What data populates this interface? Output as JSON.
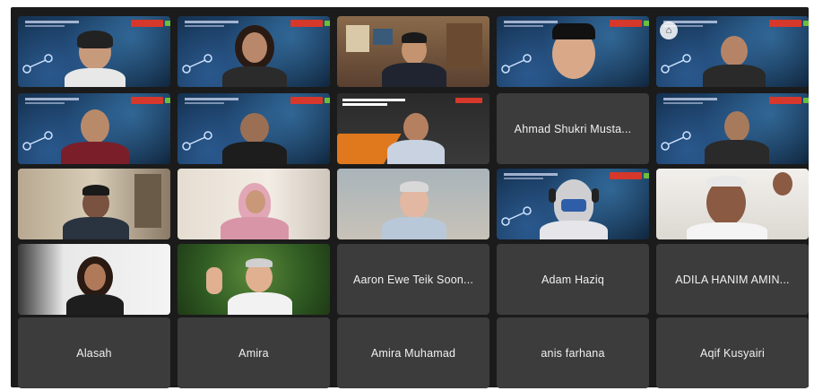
{
  "meeting": {
    "participants": [
      {
        "name": "",
        "video": true
      },
      {
        "name": "",
        "video": true
      },
      {
        "name": "",
        "video": true
      },
      {
        "name": "",
        "video": true
      },
      {
        "name": "",
        "video": true
      },
      {
        "name": "",
        "video": true
      },
      {
        "name": "",
        "video": true
      },
      {
        "name": "",
        "video": true
      },
      {
        "name": "Ahmad Shukri Musta...",
        "video": false
      },
      {
        "name": "",
        "video": true
      },
      {
        "name": "",
        "video": true
      },
      {
        "name": "",
        "video": true
      },
      {
        "name": "",
        "video": true
      },
      {
        "name": "",
        "video": true
      },
      {
        "name": "",
        "video": true
      },
      {
        "name": "",
        "video": true
      },
      {
        "name": "",
        "video": true
      },
      {
        "name": "Aaron Ewe Teik Soon...",
        "video": false
      },
      {
        "name": "Adam Haziq",
        "video": false
      },
      {
        "name": "ADILA HANIM AMIN...",
        "video": false
      },
      {
        "name": "Alasah",
        "video": false
      },
      {
        "name": "Amira",
        "video": false
      },
      {
        "name": "Amira Muhamad",
        "video": false
      },
      {
        "name": "anis farhana",
        "video": false
      },
      {
        "name": "Aqif Kusyairi",
        "video": false
      }
    ]
  },
  "icons": {
    "lock": "lock-icon"
  },
  "colors": {
    "background": "#1b1b1b",
    "tile": "#3c3c3c",
    "conference_red": "#d6382b",
    "conference_green": "#6bbf3a"
  }
}
